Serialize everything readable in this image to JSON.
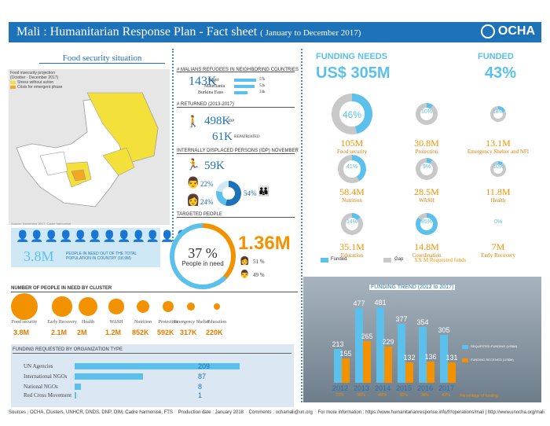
{
  "header": {
    "title": "Mali : Humanitarian Response Plan - Fact sheet",
    "period": "( January to December 2017)",
    "logo": "OCHA"
  },
  "food_security": {
    "title": "Food security situation",
    "legend_title": "Food insecurity projection",
    "legend_sub": "(October - December 2017)",
    "legend_items": [
      "Stress without action",
      "Crisis for emergent phase"
    ],
    "source": "Source: November 2017, Cadre harmonisé"
  },
  "refugees": {
    "title": "# MALIANS REFUGEES IN NEIGHBORING COUNTRIES",
    "total": "143K",
    "countries": [
      {
        "name": "Niger",
        "value": "57k",
        "share": 0.98
      },
      {
        "name": "Mauritania",
        "value": "52k",
        "share": 0.9
      },
      {
        "name": "Burkina Faso",
        "value": "34k",
        "share": 0.6
      }
    ]
  },
  "returned": {
    "title": "# RETURNED (2013-2017)",
    "idp_value": "498K",
    "idp_label": "IDP",
    "repatriated_value": "61K",
    "repatriated_label": "REPATRIATED"
  },
  "idp": {
    "title": "INTERNALLY DISPLACED PERSONS (IDP) NOVEMBER",
    "value": "59K",
    "pct_men": "22%",
    "pct_women": "24%",
    "pct_children": "54%"
  },
  "targeted": {
    "title": "TARGETED PEOPLE",
    "in_need_value": "3.8M",
    "in_need_text": "PEOPLE IN NEED OUT OF THE TOTAL POPULATION IN COUNTRY (18.9M)",
    "pct": "37 %",
    "pct_label": "People in need",
    "targeted_value": "1.36M",
    "female_pct": "51 %",
    "male_pct": "49 %"
  },
  "clusters": {
    "title": "NUMBER OF PEOPLE IN NEED BY CLUSTER",
    "items": [
      {
        "name": "Food security",
        "value": "3.8M",
        "millions": 3.8
      },
      {
        "name": "Early Recovery",
        "value": "2.1M",
        "millions": 2.1
      },
      {
        "name": "Health",
        "value": "2M",
        "millions": 2.0
      },
      {
        "name": "WASH",
        "value": "1.2M",
        "millions": 1.2
      },
      {
        "name": "Nutrition",
        "value": "852K",
        "millions": 0.852
      },
      {
        "name": "Protection",
        "value": "592K",
        "millions": 0.592
      },
      {
        "name": "Emergency Shelter",
        "value": "317K",
        "millions": 0.317
      },
      {
        "name": "Education",
        "value": "220K",
        "millions": 0.22
      }
    ]
  },
  "orgs": {
    "title": "FUNDING REQUESTED BY ORGANIZATION TYPE",
    "items": [
      {
        "name": "UN Agencies",
        "value": "209",
        "count": 209
      },
      {
        "name": "International NGOs",
        "value": "87",
        "count": 87
      },
      {
        "name": "National NGOs",
        "value": "8",
        "count": 8
      },
      {
        "name": "Red Cross Movement",
        "value": "1",
        "count": 1
      }
    ]
  },
  "funding": {
    "needs_title": "FUNDING NEEDS",
    "needs_value": "US$ 305M",
    "funded_title": "FUNDED",
    "funded_value": "43%",
    "sectors": [
      {
        "pct": "46%",
        "amount": "105M",
        "name": "Food security",
        "funded": 0.46
      },
      {
        "pct": "10%",
        "amount": "30.8M",
        "name": "Protection",
        "funded": 0.1
      },
      {
        "pct": "18%",
        "amount": "13.1M",
        "name": "Emergency Shelter and NFI",
        "funded": 0.18
      },
      {
        "pct": "41%",
        "amount": "58.4M",
        "name": "Nutrition",
        "funded": 0.41
      },
      {
        "pct": "9%",
        "amount": "28.5M",
        "name": "WASH",
        "funded": 0.09
      },
      {
        "pct": "10%",
        "amount": "11.8M",
        "name": "Health",
        "funded": 0.1
      },
      {
        "pct": "14%",
        "amount": "35.1M",
        "name": "Education",
        "funded": 0.14
      },
      {
        "pct": "85%",
        "amount": "14.8M",
        "name": "Coordination",
        "funded": 0.85
      },
      {
        "pct": "0%",
        "amount": "7M",
        "name": "Early Recovery",
        "funded": 0.0
      }
    ],
    "legend_funded": "Funded",
    "legend_gap": "Gap",
    "legend_requested": "XX M  Requested funds"
  },
  "trend": {
    "title": "FUNDING TREND (2012 to 2017)",
    "legend_requested": "REQUESTED FUNDING (US$M)",
    "legend_funded": "FUNDING RECEIVED (US$M)",
    "pct_label": "Percentage of funding",
    "colors": {
      "requested": "#5bc0eb",
      "funded": "#f39200"
    },
    "chart_data": {
      "type": "bar",
      "categories": [
        "2012",
        "2013",
        "2014",
        "2015",
        "2016",
        "2017"
      ],
      "series": [
        {
          "name": "REQUESTED FUNDING (US$M)",
          "values": [
            213,
            477,
            481,
            377,
            354,
            305
          ]
        },
        {
          "name": "FUNDING RECEIVED (US$M)",
          "values": [
            155,
            265,
            229,
            132,
            136,
            131
          ]
        }
      ],
      "percent": [
        "73%",
        "56%",
        "48%",
        "35%",
        "38%",
        "43%"
      ],
      "ylim": [
        0,
        500
      ]
    }
  },
  "footer": {
    "sources": "Sources : OCHA, Clusters, UNHCR, DNDS, DNP, OIM, Cadre harmonisé, FTS",
    "date": "Production date : January 2018",
    "comments": "Comments : ochamali@un.org",
    "more": "For more information : https://www.humanitarianresponse.info/fr/operations/mali  |  http://www.unocha.org/mali"
  }
}
